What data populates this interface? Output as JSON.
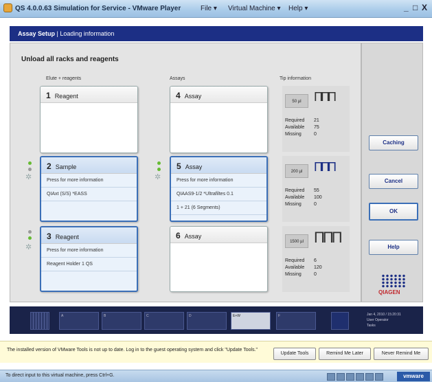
{
  "window": {
    "title": "QS 4.0.0.63 Simulation for Service - VMware Player",
    "menus": [
      "File ▾",
      "Virtual Machine ▾",
      "Help ▾"
    ],
    "controls": [
      "_",
      "□",
      "X"
    ]
  },
  "app": {
    "header_bold": "Assay Setup",
    "header_sep": " | ",
    "header_rest": "Loading information"
  },
  "main": {
    "heading": "Unload all racks and reagents",
    "col_left": "Elute + reagents",
    "col_mid": "Assays",
    "col_right": "Tip information",
    "left_cards": [
      {
        "num": "1",
        "label": "Reagent",
        "lines": []
      },
      {
        "num": "2",
        "label": "Sample",
        "lines": [
          "Press for more information",
          "QIAxt (S/S) *EASS"
        ]
      },
      {
        "num": "3",
        "label": "Reagent",
        "lines": [
          "Press for more information",
          "Reagent Holder 1 QS"
        ]
      }
    ],
    "mid_cards": [
      {
        "num": "4",
        "label": "Assay",
        "lines": []
      },
      {
        "num": "5",
        "label": "Assay",
        "lines": [
          "Press for more information",
          "QIAAS9-1/2 *Ultrafiltes 0.1",
          "1 + 21 (6 Segments)"
        ]
      },
      {
        "num": "6",
        "label": "Assay",
        "lines": []
      }
    ],
    "tips": [
      {
        "size": "50 µl",
        "required_label": "Required",
        "required": "21",
        "available_label": "Available",
        "available": "75",
        "missing_label": "Missing",
        "missing": "0"
      },
      {
        "size": "200 µl",
        "required_label": "Required",
        "required": "55",
        "available_label": "Available",
        "available": "100",
        "missing_label": "Missing",
        "missing": "0"
      },
      {
        "size": "1500 µl",
        "required_label": "Required",
        "required": "6",
        "available_label": "Available",
        "available": "120",
        "missing_label": "Missing",
        "missing": "0"
      }
    ]
  },
  "side": {
    "buttons": [
      "Caching",
      "Cancel",
      "OK",
      "Help"
    ],
    "logo_text": "QIAGEN"
  },
  "strip": {
    "slot_labels": [
      "",
      "A",
      "B",
      "C",
      "D",
      "E+W",
      "F",
      ""
    ],
    "status_lines": [
      "Jan 4, 2010 / 15:20:31",
      "User   Operator",
      "Tasks"
    ]
  },
  "notification": {
    "text": "The installed version of VMware Tools is not up to date. Log in to the guest operating system and click \"Update Tools.\"",
    "buttons": [
      "Update Tools",
      "Remind Me Later",
      "Never Remind Me"
    ]
  },
  "statusbar": {
    "text": "To direct input to this virtual machine, press Ctrl+G.",
    "brand": "vmware"
  }
}
